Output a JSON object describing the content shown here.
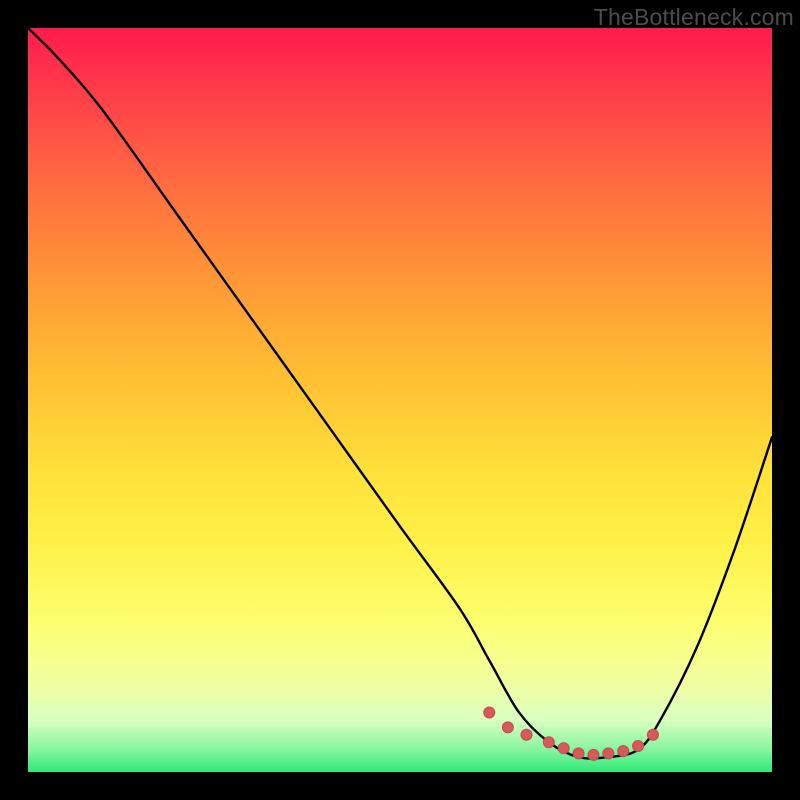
{
  "watermark": "TheBottleneck.com",
  "colors": {
    "frame_bg": "#000000",
    "curve_stroke": "#000000",
    "marker_fill": "#d65a5a",
    "marker_stroke": "#c34b4b"
  },
  "chart_data": {
    "type": "line",
    "title": "",
    "xlabel": "",
    "ylabel": "",
    "xlim": [
      0,
      100
    ],
    "ylim": [
      0,
      100
    ],
    "grid": false,
    "legend": false,
    "series": [
      {
        "name": "bottleneck-curve",
        "x": [
          0,
          4,
          10,
          20,
          30,
          40,
          50,
          58,
          62,
          66,
          70,
          74,
          78,
          82,
          85,
          90,
          95,
          100
        ],
        "y": [
          100,
          96,
          89,
          75,
          61,
          47,
          33,
          22,
          15,
          8,
          4,
          2,
          2,
          3,
          7,
          17,
          30,
          45
        ]
      }
    ],
    "markers": {
      "name": "flat-bottom-points",
      "x": [
        62,
        64.5,
        67,
        70,
        72,
        74,
        76,
        78,
        80,
        82,
        84
      ],
      "y": [
        8,
        6,
        5,
        4,
        3.2,
        2.5,
        2.3,
        2.5,
        2.8,
        3.5,
        5
      ]
    },
    "gradient_stops": [
      {
        "pos": 0.0,
        "color": "#ff1a4d"
      },
      {
        "pos": 0.22,
        "color": "#ff6f3f"
      },
      {
        "pos": 0.46,
        "color": "#ffbd33"
      },
      {
        "pos": 0.7,
        "color": "#fff24a"
      },
      {
        "pos": 0.93,
        "color": "#d9ffc0"
      },
      {
        "pos": 1.0,
        "color": "#2fe879"
      }
    ]
  }
}
